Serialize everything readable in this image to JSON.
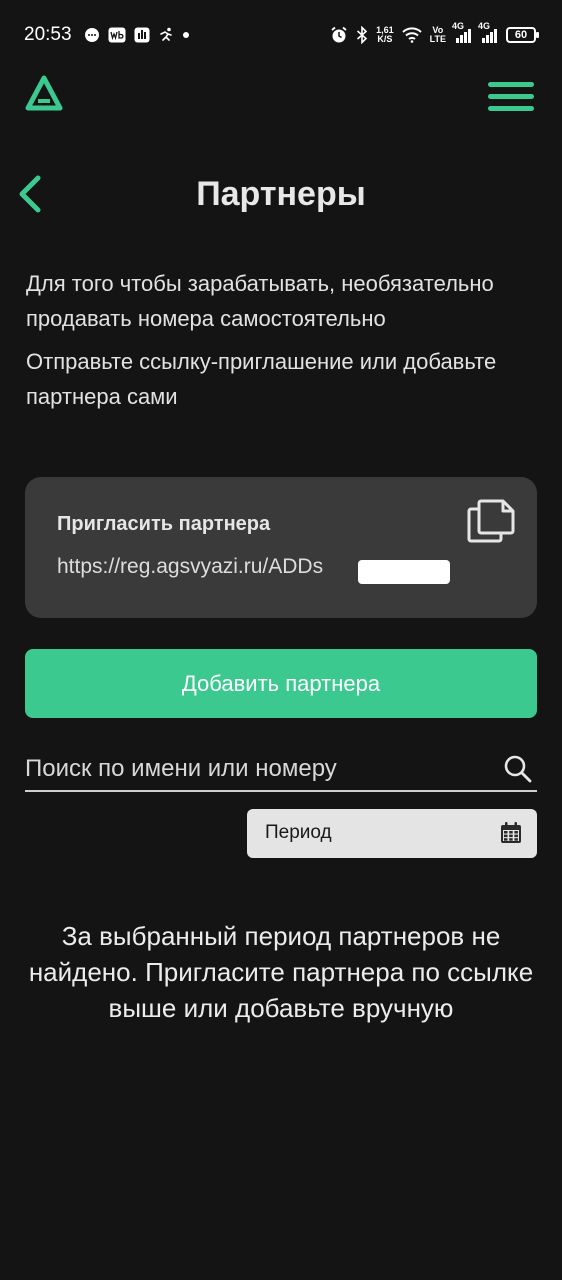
{
  "status_bar": {
    "time": "20:53",
    "net_speed_value": "1,61",
    "net_speed_unit": "K/S",
    "volte_top": "Vo",
    "volte_bottom": "LTE",
    "signal1": "4G",
    "signal2": "4G",
    "battery": "60",
    "notification_icons": [
      "chat-icon",
      "wb-icon",
      "app-icon",
      "running-icon",
      "dot-icon"
    ],
    "system_icons": [
      "alarm-icon",
      "bluetooth-icon",
      "wifi-icon"
    ]
  },
  "app_bar": {
    "logo_icon": "logo-triangle-icon",
    "menu_icon": "hamburger-menu-icon"
  },
  "header": {
    "back_icon": "chevron-left-icon",
    "title": "Партнеры"
  },
  "intro": {
    "paragraph1": "Для того чтобы зарабатывать, необязательно продавать номера самостоятельно",
    "paragraph2": "Отправьте ссылку-приглашение или добавьте партнера сами"
  },
  "invite_card": {
    "title": "Пригласить партнера",
    "link": "https://reg.agsvyazi.ru/ADDs",
    "copy_icon": "copy-icon"
  },
  "add_partner_button": "Добавить партнера",
  "search": {
    "placeholder": "Поиск по имени или номеру",
    "value": "",
    "icon": "search-icon"
  },
  "period_filter": {
    "label": "Период",
    "icon": "calendar-icon"
  },
  "empty_message": "За выбранный период партнеров не найдено. Пригласите партнера по ссылке выше или добавьте вручную",
  "colors": {
    "background": "#141414",
    "accent": "#3cc990",
    "card": "#3a3a3a",
    "period_bg": "#e4e4e4"
  }
}
